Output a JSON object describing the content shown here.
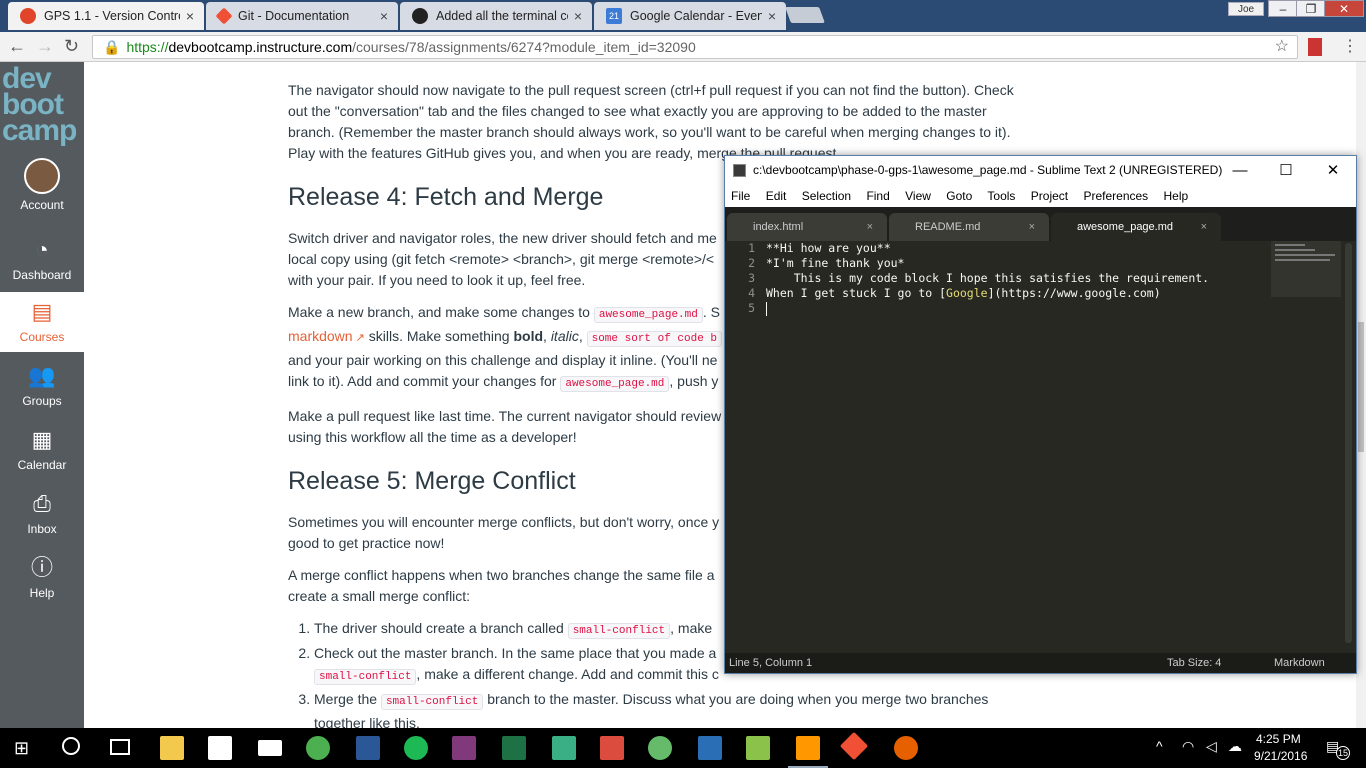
{
  "browser": {
    "tabs": [
      {
        "title": "GPS 1.1 - Version Contro",
        "close": "×",
        "icon_color": "#e0452b",
        "icon": "canvas-icon"
      },
      {
        "title": "Git - Documentation",
        "close": "×",
        "icon_color": "#f05033",
        "icon": "git-icon"
      },
      {
        "title": "Added all the terminal co",
        "close": "×",
        "icon_color": "#222222",
        "icon": "github-icon"
      },
      {
        "title": "Google Calendar - Event",
        "close": "×",
        "icon_color": "#3d7cd6",
        "icon": "calendar-icon",
        "icon_text": "21"
      }
    ],
    "profile": "Joe",
    "address": {
      "scheme": "https://",
      "host": "devbootcamp.instructure.com",
      "path": "/courses/78/assignments/6274?module_item_id=32090"
    }
  },
  "nav": {
    "logo_lines": [
      "dev",
      "boot",
      "camp"
    ],
    "items": [
      {
        "label": "Account",
        "icon": "avatar-icon"
      },
      {
        "label": "Dashboard",
        "icon": "dashboard-icon"
      },
      {
        "label": "Courses",
        "icon": "courses-icon"
      },
      {
        "label": "Groups",
        "icon": "groups-icon"
      },
      {
        "label": "Calendar",
        "icon": "calendar-icon"
      },
      {
        "label": "Inbox",
        "icon": "inbox-icon"
      },
      {
        "label": "Help",
        "icon": "help-icon"
      }
    ],
    "active_color": "#e66135"
  },
  "article": {
    "p1": "The navigator should now navigate to the pull request screen (ctrl+f pull request if you can not find the button). Check out the \"conversation\" tab and the files changed to see what exactly you are approving to be added to the master branch. (Remember the master branch should always work, so you'll want to be careful when merging changes to it). Play with the features GitHub gives you, and when you are ready, merge the pull request.",
    "h_release4": "Release 4: Fetch and Merge",
    "p2": "Switch driver and navigator roles, the new driver should fetch and me",
    "p2b": "local copy using (git fetch <remote> <branch>, git merge <remote>/<",
    "p2c": "with your pair. If you need to look it up, feel free.",
    "p3a": "Make a new branch, and make some changes to ",
    "p3_code": "awesome_page.md",
    "p3b": ". S",
    "p3_link": "markdown",
    "p3c": " skills. Make something ",
    "p3_bold": "bold",
    "p3d": ", ",
    "p3_italic": "italic",
    "p3e": ", ",
    "p3_code2": "some sort of code b",
    "p3f": "and your pair working on this challenge and display it inline. (You'll ne",
    "p3g": "link to it). Add and commit your changes for ",
    "p3_code3": "awesome_page.md",
    "p3h": ", push y",
    "p4a": "Make a pull request like last time. The current navigator should review",
    "p4b": "using this workflow all the time as a developer!",
    "h_release5": "Release 5: Merge Conflict",
    "p5a": "Sometimes you will encounter merge conflicts, but don't worry, once y",
    "p5b": "good to get practice now!",
    "p6a": "A merge conflict happens when two branches change the same file a",
    "p6b": "create a small merge conflict:",
    "li1a": "The driver should create a branch called ",
    "li1_code": "small-conflict",
    "li1b": ", make",
    "li2a": "Check out the master branch. In the same place that you made a",
    "li2_code": "small-conflict",
    "li2b": ", make a different change. Add and commit this c",
    "li3a": "Merge the ",
    "li3_code": "small-conflict",
    "li3b": " branch to the master. Discuss what you are doing when you merge two branches together like this."
  },
  "sublime": {
    "title": "c:\\devbootcamp\\phase-0-gps-1\\awesome_page.md - Sublime Text 2 (UNREGISTERED)",
    "window_controls": [
      "—",
      "☐",
      "✕"
    ],
    "menu": [
      "File",
      "Edit",
      "Selection",
      "Find",
      "View",
      "Goto",
      "Tools",
      "Project",
      "Preferences",
      "Help"
    ],
    "tabs": [
      {
        "name": "index.html",
        "close": "×"
      },
      {
        "name": "README.md",
        "close": "×"
      },
      {
        "name": "awesome_page.md",
        "close": "×"
      }
    ],
    "line_numbers": [
      "1",
      "2",
      "3",
      "4",
      "5"
    ],
    "code": {
      "l1": "**Hi how are you**",
      "l2": "*I'm fine thank you*",
      "l3": "    This is my code block I hope this satisfies the requirement.",
      "l4_pre": "When I get stuck I go to [",
      "l4_link": "Google",
      "l4_post": "](https://www.google.com)"
    },
    "status_left": "Line 5, Column 1",
    "status_tab": "Tab Size: 4",
    "status_syntax": "Markdown"
  },
  "taskbar": {
    "time": "4:25 PM",
    "date": "9/21/2016",
    "notifications": "15",
    "apps": [
      {
        "name": "task-view-icon",
        "color": "#ffffff"
      },
      {
        "name": "file-explorer-icon",
        "color": "#f2c94c"
      },
      {
        "name": "calendar-app-icon",
        "color": "#ffffff"
      },
      {
        "name": "mail-icon",
        "color": "#ffffff"
      },
      {
        "name": "chrome-icon",
        "color": "#4caf50"
      },
      {
        "name": "word-icon",
        "color": "#2b5797"
      },
      {
        "name": "spotify-icon",
        "color": "#1db954"
      },
      {
        "name": "onenote-icon",
        "color": "#80397b"
      },
      {
        "name": "excel-icon",
        "color": "#1e7145"
      },
      {
        "name": "slack-icon",
        "color": "#3aaf85"
      },
      {
        "name": "todoist-icon",
        "color": "#db4c3f"
      },
      {
        "name": "atom-icon",
        "color": "#66bb6a"
      },
      {
        "name": "powershell-icon",
        "color": "#2a6fb5"
      },
      {
        "name": "notepad-icon",
        "color": "#8bc34a"
      },
      {
        "name": "sublime-icon",
        "color": "#ff9800"
      },
      {
        "name": "git-icon",
        "color": "#f05033"
      },
      {
        "name": "firefox-icon",
        "color": "#e66000"
      }
    ]
  }
}
